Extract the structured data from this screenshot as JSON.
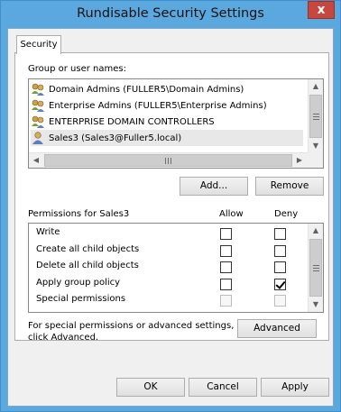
{
  "window": {
    "title": "Rundisable Security Settings",
    "close_glyph": "x"
  },
  "tabs": [
    {
      "label": "Security",
      "active": true
    }
  ],
  "group_section": {
    "label": "Group or user names:",
    "items": [
      {
        "name": "Domain Admins (FULLER5\\Domain Admins)",
        "icon": "group-users-icon",
        "selected": false
      },
      {
        "name": "Enterprise Admins (FULLER5\\Enterprise Admins)",
        "icon": "group-users-icon",
        "selected": false
      },
      {
        "name": "ENTERPRISE DOMAIN CONTROLLERS",
        "icon": "group-users-icon",
        "selected": false
      },
      {
        "name": "Sales3 (Sales3@Fuller5.local)",
        "icon": "single-user-icon",
        "selected": true
      }
    ]
  },
  "buttons": {
    "add": "Add...",
    "remove": "Remove",
    "advanced": "Advanced",
    "ok": "OK",
    "cancel": "Cancel",
    "apply": "Apply"
  },
  "permissions": {
    "label": "Permissions for Sales3",
    "allow_header": "Allow",
    "deny_header": "Deny",
    "rows": [
      {
        "name": "Write",
        "allow": false,
        "deny": false,
        "disabled": false
      },
      {
        "name": "Create all child objects",
        "allow": false,
        "deny": false,
        "disabled": false
      },
      {
        "name": "Delete all child objects",
        "allow": false,
        "deny": false,
        "disabled": false
      },
      {
        "name": "Apply group policy",
        "allow": false,
        "deny": true,
        "disabled": false
      },
      {
        "name": "Special permissions",
        "allow": false,
        "deny": false,
        "disabled": true
      }
    ]
  },
  "advanced_note": "For special permissions or advanced settings,\nclick Advanced."
}
